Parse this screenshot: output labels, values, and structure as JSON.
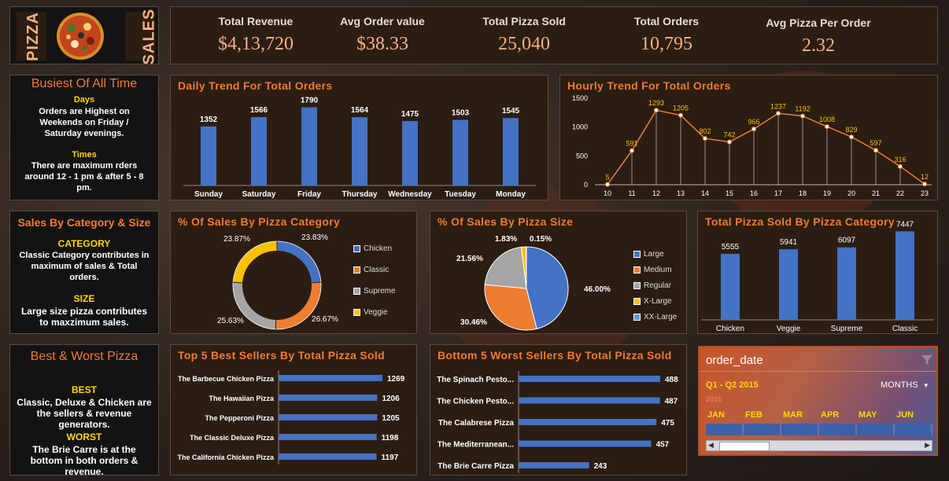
{
  "header": {
    "title_left": "PIZZA",
    "title_right": "SALES"
  },
  "kpis": [
    {
      "label": "Total Revenue",
      "value": "$4,13,720"
    },
    {
      "label": "Avg Order value",
      "value": "$38.33"
    },
    {
      "label": "Total Pizza Sold",
      "value": "25,040"
    },
    {
      "label": "Total Orders",
      "value": "10,795"
    },
    {
      "label": "Avg Pizza Per Order",
      "value": "2.32"
    }
  ],
  "busiest": {
    "title": "Busiest Of All Time",
    "days_head": "Days",
    "days_text": "Orders are Highest on Weekends on Friday / Saturday evenings.",
    "times_head": "Times",
    "times_text": "There are maximum rders around 12 - 1 pm & after 5 - 8 pm."
  },
  "category_note": {
    "title": "Sales By Category & Size",
    "cat_head": "CATEGORY",
    "cat_text": "Classic Category contributes in maximum of sales & Total orders.",
    "size_head": "SIZE",
    "size_text": "Large size pizza contributes to maxzimum sales."
  },
  "bestworst": {
    "title": "Best & Worst Pizza",
    "best_head": "BEST",
    "best_text": "Classic, Deluxe & Chicken are the sellers & revenue generators.",
    "worst_head": "WORST",
    "worst_text": "The Brie Carre is at the bottom in both orders & revenue."
  },
  "colors": {
    "accent": "#f07b2e",
    "bar": "#4472c4",
    "orange": "#ed7d31",
    "gray": "#a5a5a5",
    "yellow": "#ffc000",
    "panel": "#2b1d12"
  },
  "chart_data": [
    {
      "id": "daily",
      "type": "bar",
      "title": "Daily Trend For Total Orders",
      "categories": [
        "Sunday",
        "Saturday",
        "Friday",
        "Thursday",
        "Wednesday",
        "Tuesday",
        "Monday"
      ],
      "values": [
        1352,
        1566,
        1790,
        1564,
        1475,
        1503,
        1545
      ]
    },
    {
      "id": "hourly",
      "type": "line",
      "title": "Hourly Trend For Total Orders",
      "x": [
        10,
        11,
        12,
        13,
        14,
        15,
        16,
        17,
        18,
        19,
        20,
        21,
        22,
        23
      ],
      "values": [
        5,
        591,
        1293,
        1205,
        802,
        742,
        966,
        1237,
        1192,
        1008,
        829,
        597,
        316,
        12
      ],
      "yticks": [
        0,
        500,
        1000,
        1500
      ],
      "ylim": [
        0,
        1500
      ]
    },
    {
      "id": "category_pct",
      "type": "pie",
      "title": "% Of Sales By Pizza Category",
      "labels": [
        "Chicken",
        "Classic",
        "Supreme",
        "Veggie"
      ],
      "values": [
        23.83,
        26.67,
        25.63,
        23.87
      ],
      "value_labels": [
        "23.83%",
        "26.67%",
        "25.63%",
        "23.87%"
      ]
    },
    {
      "id": "size_pct",
      "type": "pie",
      "title": "% Of Sales By Pizza Size",
      "labels": [
        "Large",
        "Medium",
        "Regular",
        "X-Large",
        "XX-Large"
      ],
      "values": [
        46.0,
        30.46,
        21.56,
        1.83,
        0.15
      ],
      "value_labels": [
        "46.00%",
        "30.46%",
        "21.56%",
        "1.83%",
        "0.15%"
      ]
    },
    {
      "id": "cat_sold",
      "type": "bar",
      "title": "Total Pizza Sold By Pizza Category",
      "categories": [
        "Chicken",
        "Veggie",
        "Supreme",
        "Classic"
      ],
      "values": [
        5555,
        5941,
        6097,
        7447
      ]
    },
    {
      "id": "top5",
      "type": "bar",
      "title": "Top 5 Best Sellers By Total Pizza Sold",
      "categories": [
        "The Barbecue Chicken Pizza",
        "The Hawaiian Pizza",
        "The Pepperoni Pizza",
        "The Classic Deluxe Pizza",
        "The California Chicken Pizza"
      ],
      "values": [
        1269,
        1206,
        1205,
        1198,
        1197
      ]
    },
    {
      "id": "bottom5",
      "type": "bar",
      "title": "Bottom 5 Worst Sellers By Total Pizza Sold",
      "categories": [
        "The Spinach Pesto...",
        "The Chicken Pesto...",
        "The Calabrese Pizza",
        "The Mediterranean...",
        "The Brie Carre Pizza"
      ],
      "values": [
        488,
        487,
        475,
        457,
        243
      ]
    }
  ],
  "slicer": {
    "field": "order_date",
    "range": "Q1 - Q2 2015",
    "level": "MONTHS",
    "year": "2015",
    "months": [
      "JAN",
      "FEB",
      "MAR",
      "APR",
      "MAY",
      "JUN"
    ]
  }
}
